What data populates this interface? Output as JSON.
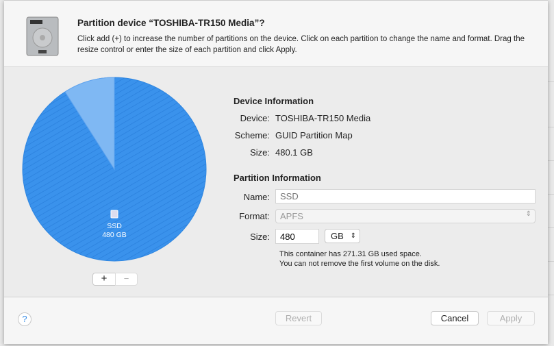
{
  "dialog": {
    "title": "Partition device “TOSHIBA-TR150 Media”?",
    "description": "Click add (+) to increase the number of partitions on the device. Click on each partition to change the name and format. Drag the resize control or enter the size of each partition and click Apply."
  },
  "pie": {
    "partition_name": "SSD",
    "partition_size": "480 GB",
    "main_color": "#3a92ec",
    "free_color": "#7fb8f3"
  },
  "device_info": {
    "heading": "Device Information",
    "device_label": "Device:",
    "device": "TOSHIBA-TR150 Media",
    "scheme_label": "Scheme:",
    "scheme": "GUID Partition Map",
    "size_label": "Size:",
    "size": "480.1 GB"
  },
  "partition_info": {
    "heading": "Partition Information",
    "name_label": "Name:",
    "name_placeholder": "SSD",
    "format_label": "Format:",
    "format": "APFS",
    "size_label": "Size:",
    "size": "480",
    "unit": "GB",
    "note1": "This container has 271.31 GB used space.",
    "note2": "You can not remove the first volume on the disk."
  },
  "buttons": {
    "add": "+",
    "remove": "−",
    "help": "?",
    "revert": "Revert",
    "cancel": "Cancel",
    "apply": "Apply"
  }
}
